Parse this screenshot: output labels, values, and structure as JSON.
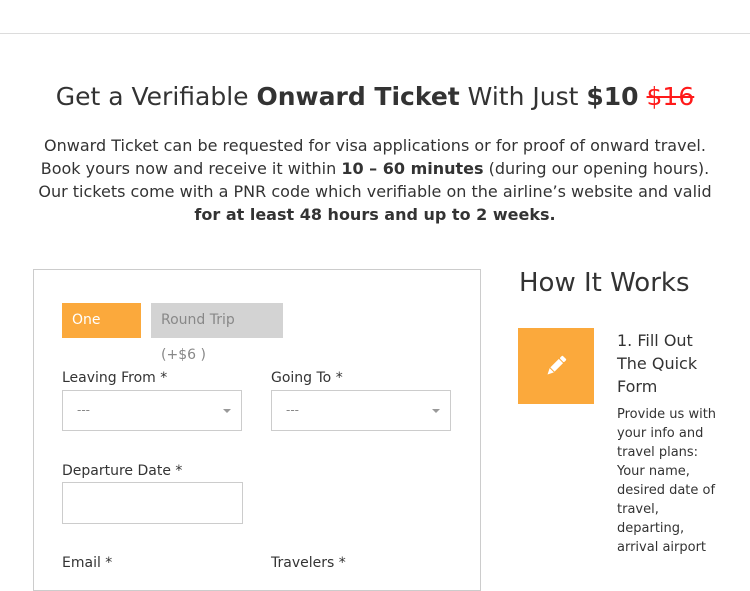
{
  "headline": {
    "prefix": "Get a Verifiable ",
    "emphasis": "Onward Ticket",
    "middle": " With Just ",
    "price": "$10",
    "old_price": "$16"
  },
  "intro": {
    "line1": "Onward Ticket can be requested for visa applications or for proof of onward travel.",
    "line2_pre": "Book yours now and receive it within ",
    "line2_bold": "10 – 60 minutes",
    "line2_post": " (during our opening hours).",
    "line3": "Our tickets come with a PNR code which verifiable on the airline’s website and valid",
    "line4_bold": "for at least 48 hours and up to 2 weeks."
  },
  "form": {
    "tabs": [
      {
        "label": "One Way",
        "active": true
      },
      {
        "label": "Round Trip (+$6 )",
        "active": false
      }
    ],
    "leaving_from": {
      "label": "Leaving From *",
      "value": "---"
    },
    "going_to": {
      "label": "Going To *",
      "value": "---"
    },
    "departure_date": {
      "label": "Departure Date *",
      "value": ""
    },
    "email": {
      "label": "Email *"
    },
    "travelers": {
      "label": "Travelers *"
    }
  },
  "how_it_works": {
    "title": "How It Works",
    "step1": {
      "icon": "pencil-icon",
      "title": "1. Fill Out The Quick Form",
      "description": "Provide us with your info and travel plans: Your name, desired date of travel, departing, arrival airport"
    }
  },
  "colors": {
    "accent": "#fba93c",
    "strike_price": "#ff1a1a",
    "inactive_tab": "#d3d3d3"
  }
}
